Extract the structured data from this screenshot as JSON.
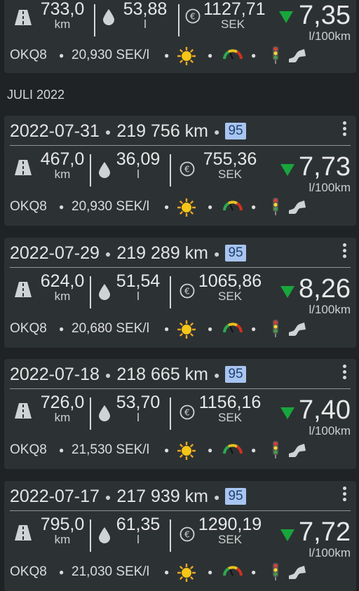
{
  "section_label": "JULI 2022",
  "units": {
    "km": "km",
    "liters": "l",
    "currency": "SEK",
    "consumption": "l/100km"
  },
  "partial_top": {
    "distance": "733,0",
    "liters": "53,88",
    "cost": "1127,71",
    "consumption": "7,35",
    "station": "OKQ8",
    "price": "20,930 SEK/l"
  },
  "entries": [
    {
      "date": "2022-07-31",
      "odometer": "219 756 km",
      "octane": "95",
      "distance": "467,0",
      "liters": "36,09",
      "cost": "755,36",
      "consumption": "7,73",
      "station": "OKQ8",
      "price": "20,930 SEK/l"
    },
    {
      "date": "2022-07-29",
      "odometer": "219 289 km",
      "octane": "95",
      "distance": "624,0",
      "liters": "51,54",
      "cost": "1065,86",
      "consumption": "8,26",
      "station": "OKQ8",
      "price": "20,680 SEK/l"
    },
    {
      "date": "2022-07-18",
      "odometer": "218 665 km",
      "octane": "95",
      "distance": "726,0",
      "liters": "53,70",
      "cost": "1156,16",
      "consumption": "7,40",
      "station": "OKQ8",
      "price": "21,530 SEK/l"
    },
    {
      "date": "2022-07-17",
      "odometer": "217 939 km",
      "octane": "95",
      "distance": "795,0",
      "liters": "61,35",
      "cost": "1290,19",
      "consumption": "7,72",
      "station": "OKQ8",
      "price": "21,030 SEK/l"
    }
  ],
  "colors": {
    "trend_down": "#18a63c",
    "sun": "#f5a623",
    "badge_bg": "#a8c4f0"
  },
  "icons": [
    "road-icon",
    "drop-icon",
    "euro-icon",
    "trend-down-icon",
    "sun-icon",
    "gauge-icon",
    "traffic-light-icon",
    "winding-road-icon",
    "more-vert-icon"
  ]
}
